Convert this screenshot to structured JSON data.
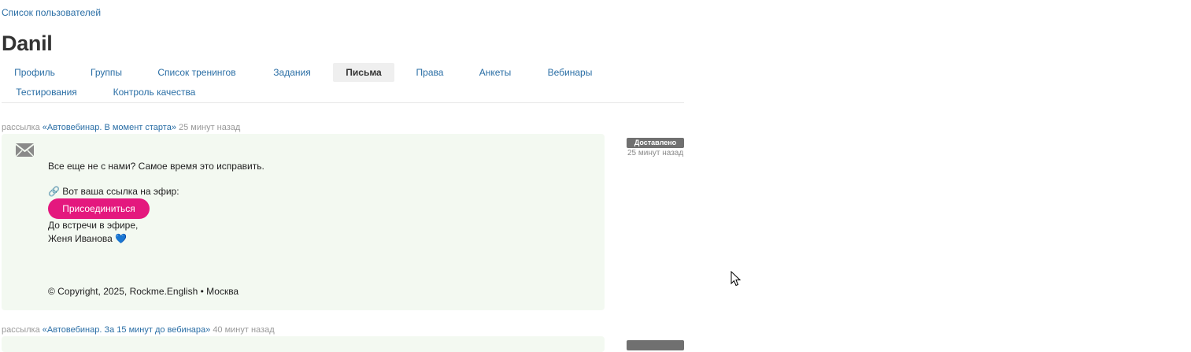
{
  "breadcrumb": "Список пользователей",
  "page_title": "Danil",
  "tabs": [
    {
      "label": "Профиль",
      "active": false
    },
    {
      "label": "Группы",
      "active": false
    },
    {
      "label": "Список тренингов",
      "active": false
    },
    {
      "label": "Задания",
      "active": false
    },
    {
      "label": "Письма",
      "active": true
    },
    {
      "label": "Права",
      "active": false
    },
    {
      "label": "Анкеты",
      "active": false
    },
    {
      "label": "Вебинары",
      "active": false
    },
    {
      "label": "Тестирования",
      "active": false
    },
    {
      "label": "Контроль качества",
      "active": false
    }
  ],
  "messages": [
    {
      "prefix": "рассылка",
      "campaign": "«Автовебинар. В момент старта»",
      "time": "25 минут назад",
      "status": "Доставлено",
      "status_time": "25 минут назад",
      "line1": "Все еще не с нами? Самое время это исправить.",
      "line2": "🔗 Вот ваша ссылка на эфир:",
      "button": "Присоединиться",
      "line3": "До встречи в эфире,",
      "line4": "Женя Иванова",
      "heart": "💙",
      "footer": "© Copyright, 2025, Rockme.English • Москва",
      "icon": "envelope-icon"
    },
    {
      "prefix": "рассылка",
      "campaign": "«Автовебинар. За 15 минут до вебинара»",
      "time": "40 минут назад",
      "icon": "envelope-icon"
    }
  ],
  "colors": {
    "link": "#2a6ea5",
    "card_bg": "#f3f9f1",
    "button_bg": "#e4187e",
    "status_bg": "#707070"
  }
}
